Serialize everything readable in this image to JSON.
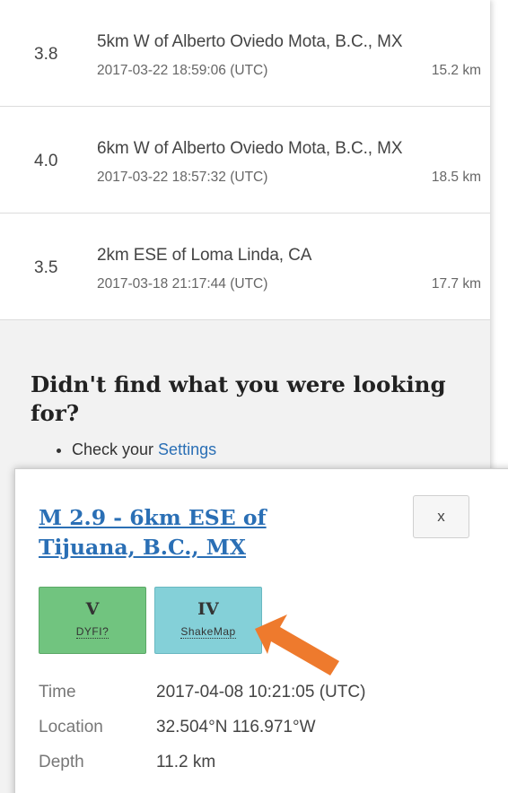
{
  "quake_list": [
    {
      "magnitude": "3.8",
      "place": "5km W of Alberto Oviedo Mota, B.C., MX",
      "time": "2017-03-22 18:59:06 (UTC)",
      "depth": "15.2 km"
    },
    {
      "magnitude": "4.0",
      "place": "6km W of Alberto Oviedo Mota, B.C., MX",
      "time": "2017-03-22 18:57:32 (UTC)",
      "depth": "18.5 km"
    },
    {
      "magnitude": "3.5",
      "place": "2km ESE of Loma Linda, CA",
      "time": "2017-03-18 21:17:44 (UTC)",
      "depth": "17.7 km"
    }
  ],
  "help": {
    "title": "Didn't find what you were looking for?",
    "items": [
      {
        "prefix": "Check your ",
        "link": "Settings"
      }
    ]
  },
  "popup": {
    "title": "M 2.9 - 6km ESE of Tijuana, B.C., MX",
    "close_label": "x",
    "badges": {
      "dyfi": {
        "value": "V",
        "label": "DYFI?"
      },
      "shakemap": {
        "value": "IV",
        "label": "ShakeMap"
      }
    },
    "details": [
      {
        "label": "Time",
        "value": "2017-04-08 10:21:05 (UTC)"
      },
      {
        "label": "Location",
        "value": "32.504°N 116.971°W"
      },
      {
        "label": "Depth",
        "value": "11.2 km"
      }
    ]
  },
  "colors": {
    "link": "#2a6fb5",
    "dyfi_badge": "#71c47f",
    "shakemap_badge": "#84d0d8",
    "annotation_arrow": "#ee7a2d"
  },
  "icons": {
    "annotation": "arrow-pointer-icon",
    "bullet": "bullet-icon"
  }
}
